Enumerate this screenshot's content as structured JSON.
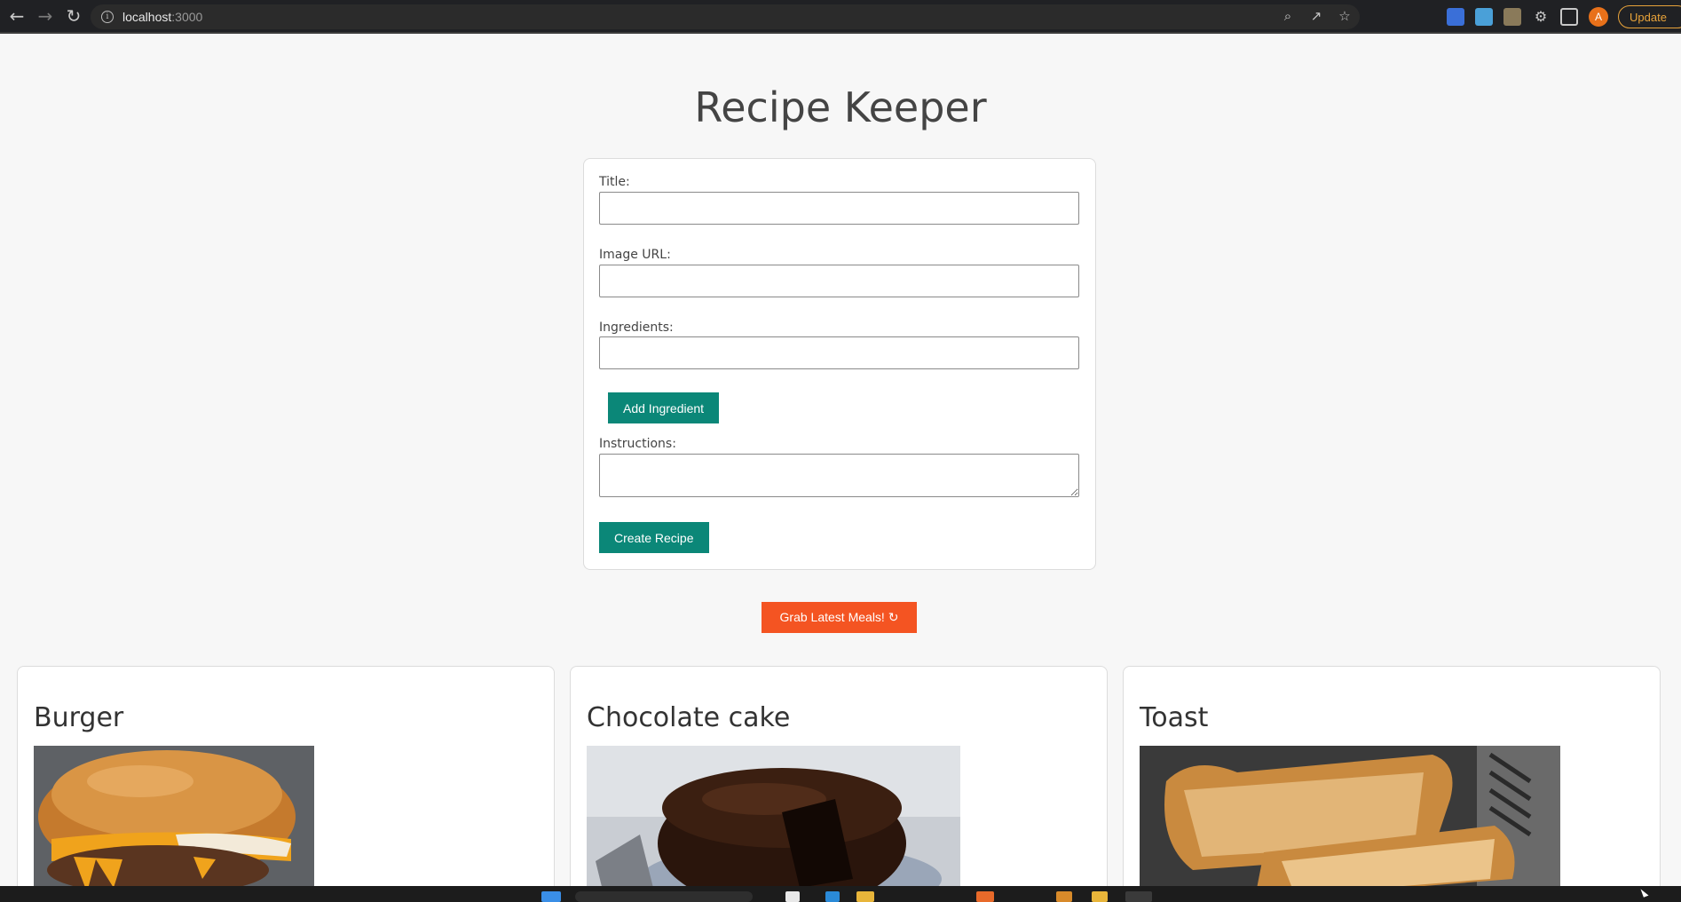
{
  "browser": {
    "url_host": "localhost",
    "url_port": ":3000",
    "avatar_letter": "A",
    "update_label": "Update"
  },
  "page": {
    "title": "Recipe Keeper"
  },
  "form": {
    "title_label": "Title:",
    "image_url_label": "Image URL:",
    "ingredients_label": "Ingredients:",
    "add_ingredient_label": "Add Ingredient",
    "instructions_label": "Instructions:",
    "create_recipe_label": "Create Recipe"
  },
  "grab_button_label": "Grab Latest Meals! ↻",
  "recipes": [
    {
      "title": "Burger"
    },
    {
      "title": "Chocolate cake"
    },
    {
      "title": "Toast"
    }
  ],
  "colors": {
    "accent_teal": "#0b8778",
    "accent_orange": "#f45422"
  }
}
